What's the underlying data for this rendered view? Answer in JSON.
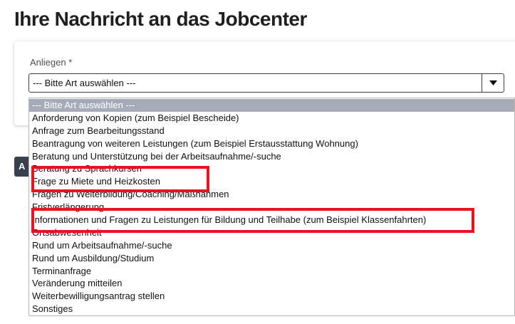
{
  "page": {
    "title": "Ihre Nachricht an das Jobcenter"
  },
  "form": {
    "label": "Anliegen *",
    "select_value": "--- Bitte Art auswählen ---",
    "side_button_label": "A"
  },
  "dropdown": {
    "options": [
      "--- Bitte Art auswählen ---",
      "Anforderung von Kopien (zum Beispiel Bescheide)",
      "Anfrage zum Bearbeitungsstand",
      "Beantragung von weiteren Leistungen (zum Beispiel Erstausstattung Wohnung)",
      "Beratung und Unterstützung bei der Arbeitsaufnahme/-suche",
      "Beratung zu Sprachkursen",
      "Frage zu Miete und Heizkosten",
      "Fragen zu Weiterbildung/Coaching/Maßnahmen",
      "Fristverlängerung",
      "Informationen und Fragen zu Leistungen für Bildung und Teilhabe (zum Beispiel Klassenfahrten)",
      "Ortsabwesenheit",
      "Rund um Arbeitsaufnahme/-suche",
      "Rund um Ausbildung/Studium",
      "Terminanfrage",
      "Veränderung mitteilen",
      "Weiterbewilligungsantrag stellen",
      "Sonstiges"
    ],
    "selected_index": 0,
    "highlighted_indices": [
      6,
      9
    ]
  },
  "icons": {
    "dropdown_arrow": "caret-down-icon"
  },
  "colors": {
    "highlight": "#e8141a",
    "selected_option_bg": "#a5acb7",
    "side_button_bg": "#3a3f4e"
  }
}
